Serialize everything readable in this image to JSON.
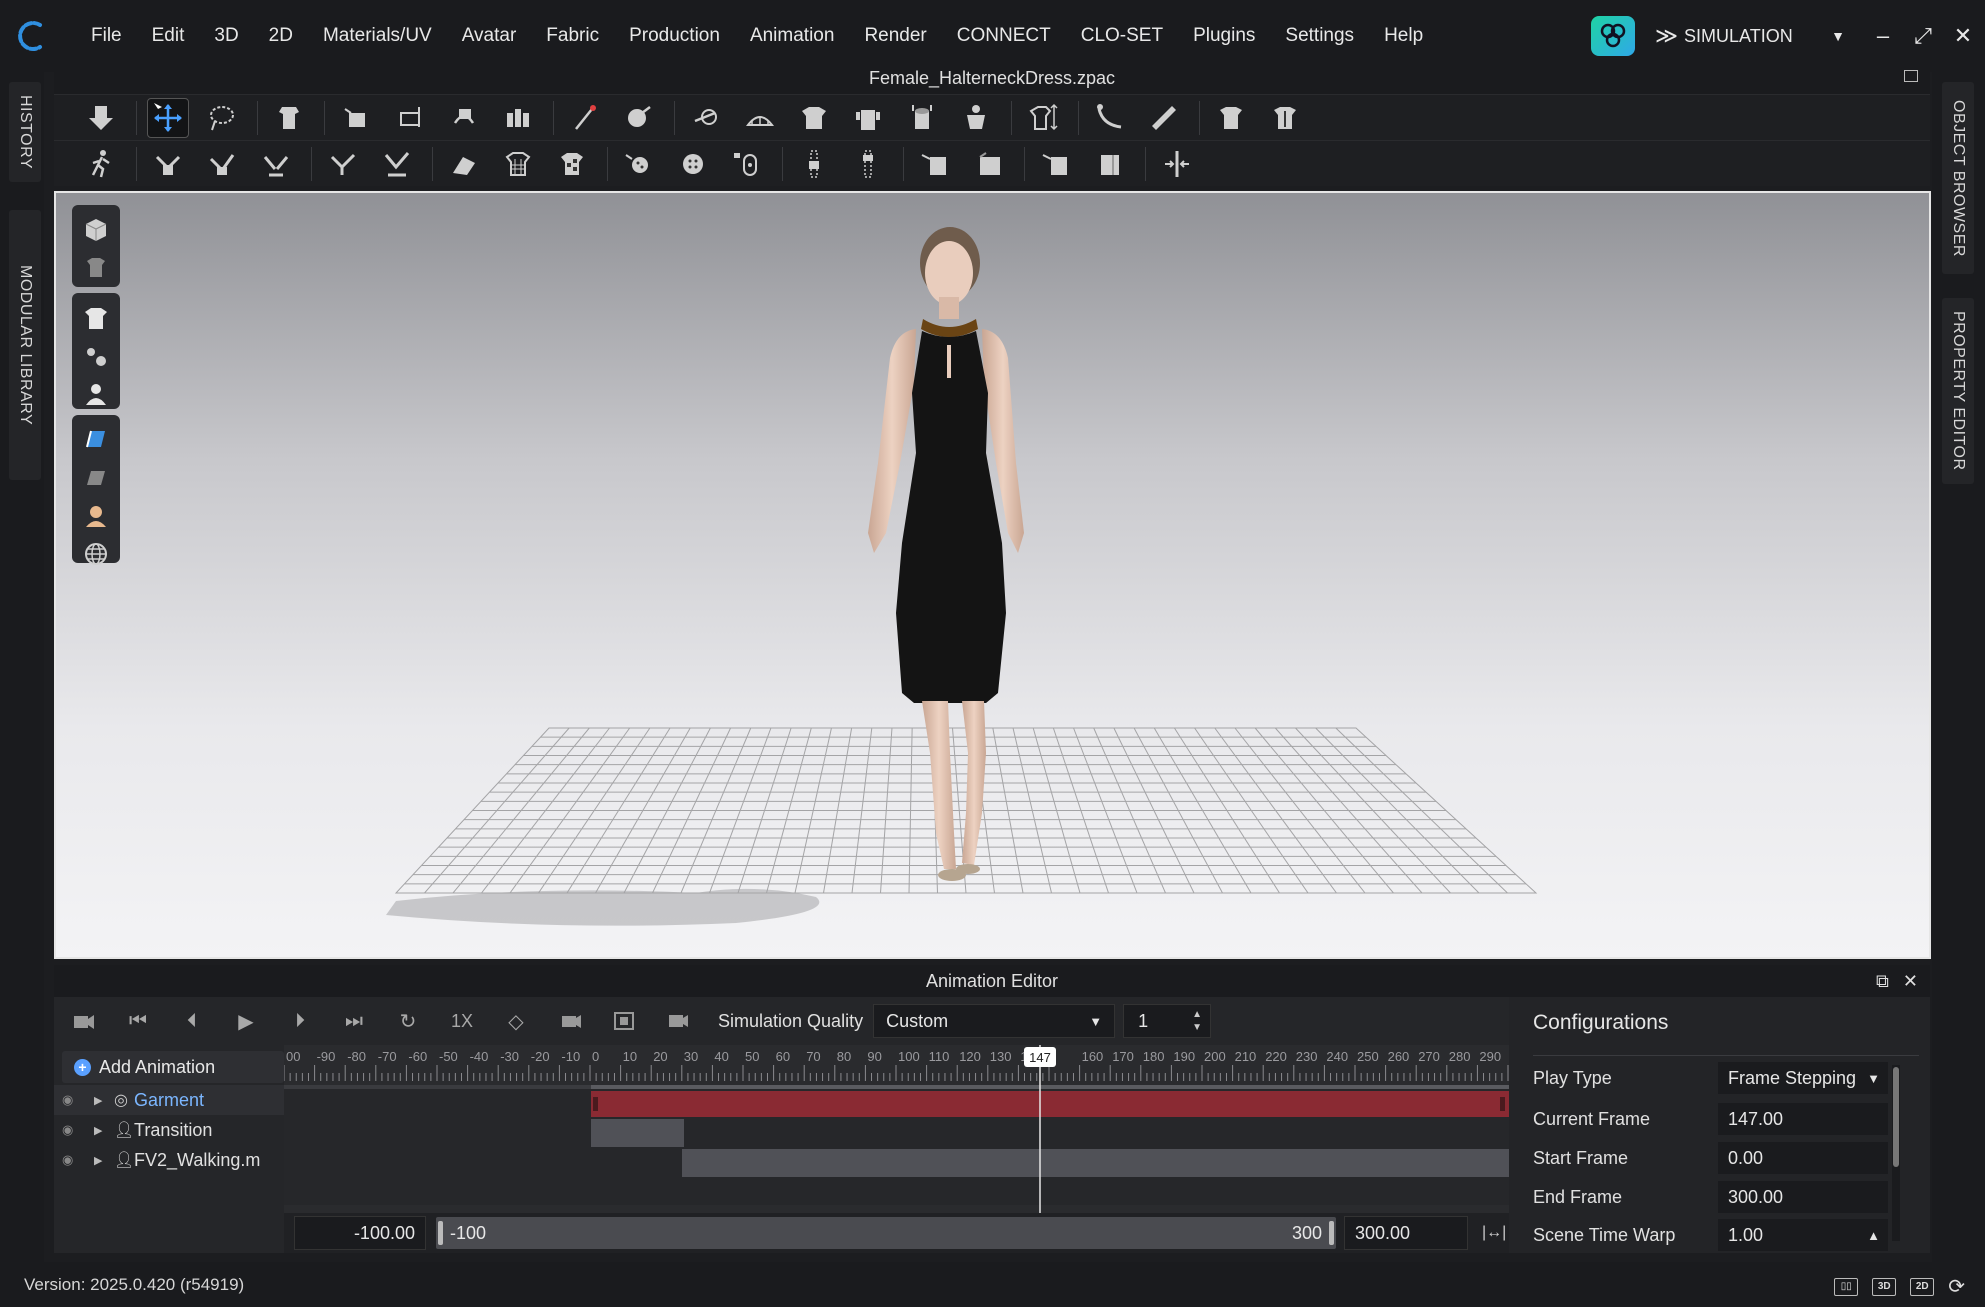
{
  "menu": [
    "File",
    "Edit",
    "3D",
    "2D",
    "Materials/UV",
    "Avatar",
    "Fabric",
    "Production",
    "Animation",
    "Render",
    "CONNECT",
    "CLO-SET",
    "Plugins",
    "Settings",
    "Help"
  ],
  "mode": {
    "label": "SIMULATION"
  },
  "window_controls": {
    "minimize": "–",
    "maximize": "⤢",
    "close": "✕"
  },
  "left_tabs": [
    "HISTORY",
    "MODULAR LIBRARY"
  ],
  "right_tabs": [
    "OBJECT BROWSER",
    "PROPERTY EDITOR"
  ],
  "document": {
    "title": "Female_HalterneckDress.zpac"
  },
  "animation_editor": {
    "title": "Animation Editor",
    "speed": "1X",
    "sim_quality_label": "Simulation Quality",
    "sim_quality_value": "Custom",
    "sim_quality_number": "1",
    "add_animation": "Add Animation",
    "tracks": [
      {
        "name": "Garment"
      },
      {
        "name": "Transition"
      },
      {
        "name": "FV2_Walking.m"
      }
    ],
    "ruler_labels": [
      "00",
      "-90",
      "-80",
      "-70",
      "-60",
      "-50",
      "-40",
      "-30",
      "-20",
      "-10",
      "0",
      "10",
      "20",
      "30",
      "40",
      "50",
      "60",
      "70",
      "80",
      "90",
      "100",
      "110",
      "120",
      "130",
      "14",
      "",
      "160",
      "170",
      "180",
      "190",
      "200",
      "210",
      "220",
      "230",
      "240",
      "250",
      "260",
      "270",
      "280",
      "290",
      "30"
    ],
    "playhead": "147",
    "range_start_value": "-100.00",
    "range_start_label": "-100",
    "range_end_label": "300",
    "range_end_value": "300.00"
  },
  "configurations": {
    "title": "Configurations",
    "rows": [
      {
        "label": "Play Type",
        "value": "Frame Stepping"
      },
      {
        "label": "Current Frame",
        "value": "147.00"
      },
      {
        "label": "Start Frame",
        "value": "0.00"
      },
      {
        "label": "End Frame",
        "value": "300.00"
      },
      {
        "label": "Scene Time Warp",
        "value": "1.00"
      }
    ]
  },
  "status": {
    "version": "Version: 2025.0.420 (r54919)",
    "view_3d": "3D",
    "view_2d": "2D"
  },
  "colors": {
    "accent": "#5aa0ff",
    "garment_track": "#8a2a33",
    "background": "#1c1d20"
  }
}
